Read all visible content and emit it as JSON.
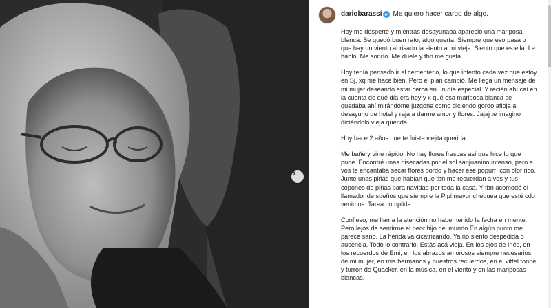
{
  "post": {
    "username": "dariobarassi",
    "headline": "Me quiero hacer cargo de algo.",
    "paragraphs": [
      "Hoy me desperté y mientras desayunaba apareció una mariposa blanca. Se quedó buen rato, algo quería. Siempre que eso pasa o que hay un viento abrisado la siento a mi vieja. Siento que es ella. Le hablo. Me sonrío. Me duele y tbn me gusta.",
      "Hoy tenía pensado ir al cementerio, lo que intento cada vez que estoy en Sj, xq me hace bien. Pero el plan cambió. Me llega un mensaje de mi mujer deseando estar cerca en un día especial. Y recién ahí caí en la cuenta de qué día era hoy y x qué esa mariposa blanca se quedaba ahí mirándome juzgona como diciendo gordo afloja al desayuno de hotel y raja a darme amor y flores. Jajaj te imagino diciéndolo vieja querida.",
      "Hoy hace 2 años que te fuiste viejita querida.",
      "Me bañé y vine rápido. No hay flores frescas así que hice lo que pude. Encontré unas disecadas por el sol sanjuanino intenso, pero a vos te encantaba secar flores bordo y hacer ese popurrí con olor rico. Junte unas piñas que habían que tbn me recuerdan a vos y tus copones de piñas para navidad por toda la casa. Y tbn acomodé el llamador de sueños que siempre la Pipi mayor chequea que esté cdo venimos. Tarea cumplida.",
      "Confieso, me llama la atención no haber tenido la fecha en mente. Pero lejos de sentirme el peor hijo del mundo En algún punto me parece sano. La herida va cicatrizando. Ya no siento despedida o ausencia. Todo lo contrario. Estás acá vieja. En los ojos de Inés, en los recuerdos de Emi, en los abrazos amorosos siempre necesarios de mi mujer, en mis hermanos y nuestros recuerdos, en el vittel tonne y turrón de Quacker, en la música, en el viento y en las mariposas blancas."
    ]
  },
  "icons": {
    "verified": "verified-badge-icon",
    "next": "chevron-right-icon",
    "avatar": "profile-avatar"
  },
  "colors": {
    "verified": "#3897f0",
    "text": "#262626"
  }
}
